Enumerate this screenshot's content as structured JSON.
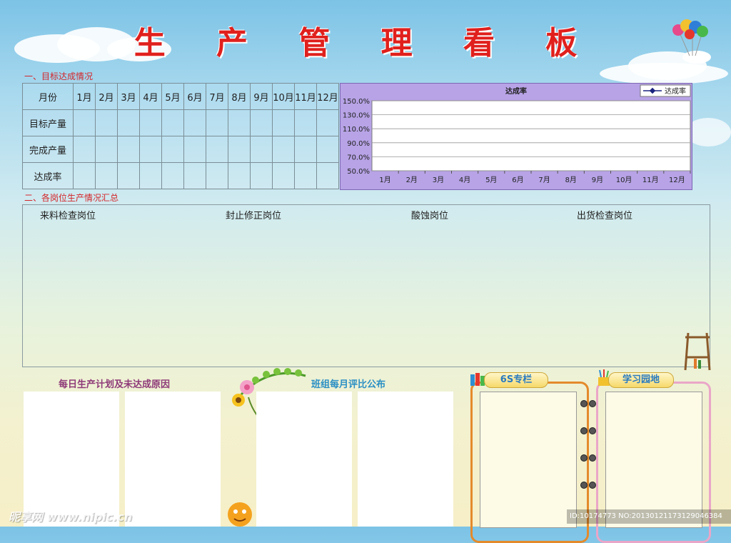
{
  "title": "生 产 管 理 看 板",
  "section1": "一、目标达成情况",
  "section2": "二、各岗位生产情况汇总",
  "table": {
    "header_label": "月份",
    "months": [
      "1月",
      "2月",
      "3月",
      "4月",
      "5月",
      "6月",
      "7月",
      "8月",
      "9月",
      "10月",
      "11月",
      "12月"
    ],
    "rows": [
      "目标产量",
      "完成产量",
      "达成率"
    ]
  },
  "chart_data": {
    "type": "line",
    "title": "达成率",
    "categories": [
      "1月",
      "2月",
      "3月",
      "4月",
      "5月",
      "6月",
      "7月",
      "8月",
      "9月",
      "10月",
      "11月",
      "12月"
    ],
    "series": [
      {
        "name": "达成率",
        "values": []
      }
    ],
    "yticks": [
      "150.0%",
      "130.0%",
      "110.0%",
      "90.0%",
      "70.0%",
      "50.0%"
    ],
    "ylim": [
      50,
      150
    ],
    "legend": "top-right",
    "grid": true
  },
  "summary": {
    "posts": [
      "来料检查岗位",
      "封止修正岗位",
      "酸蚀岗位",
      "出货检查岗位"
    ]
  },
  "daily_plan_title": "每日生产计划及未达成原因",
  "monthly_eval_title": "班组每月评比公布",
  "six_s_title": "6S专栏",
  "learning_title": "学习园地",
  "watermark": "昵享网 www.nipic.cn",
  "image_id": "ID:10174773 NO:20130121173129046384",
  "colors": {
    "title": "#e0201d",
    "section": "#d3262a",
    "chart_bg": "#b7a3e6",
    "line": "#1a237e"
  }
}
